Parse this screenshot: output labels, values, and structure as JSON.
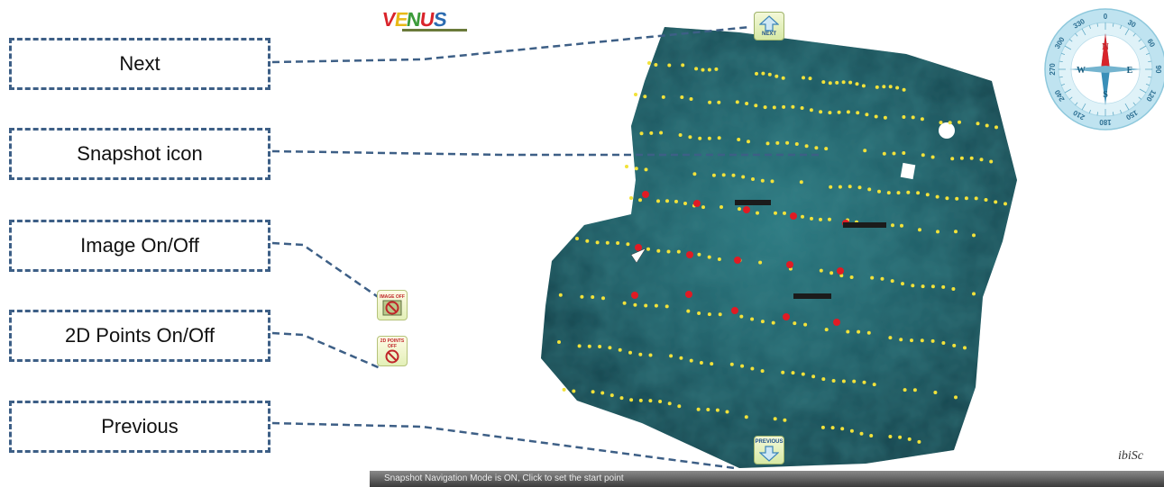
{
  "callouts": {
    "next": "Next",
    "snapshot": "Snapshot icon",
    "image_toggle": "Image On/Off",
    "points_toggle": "2D Points On/Off",
    "previous": "Previous"
  },
  "logo": {
    "letters": [
      "V",
      "E",
      "N",
      "U",
      "S"
    ]
  },
  "buttons": {
    "next_label": "NEXT",
    "previous_label": "PREVIOUS",
    "image_off_label": "IMAGE OFF",
    "points_off_label": "2D POINTS OFF"
  },
  "compass": {
    "north": "N",
    "south": "S",
    "east": "E",
    "west": "W",
    "degrees": [
      "0",
      "30",
      "60",
      "90",
      "120",
      "150",
      "180",
      "210",
      "240",
      "270",
      "300",
      "330"
    ]
  },
  "status_bar": "Snapshot Navigation Mode is ON,  Click to set the start point",
  "credit": "ibiSc",
  "colors": {
    "callout_border": "#3d5f86",
    "connector": "#3d5f86",
    "mosaic": "#1f5e66",
    "point_yellow": "#f2e23a",
    "point_red": "#e01b24"
  }
}
